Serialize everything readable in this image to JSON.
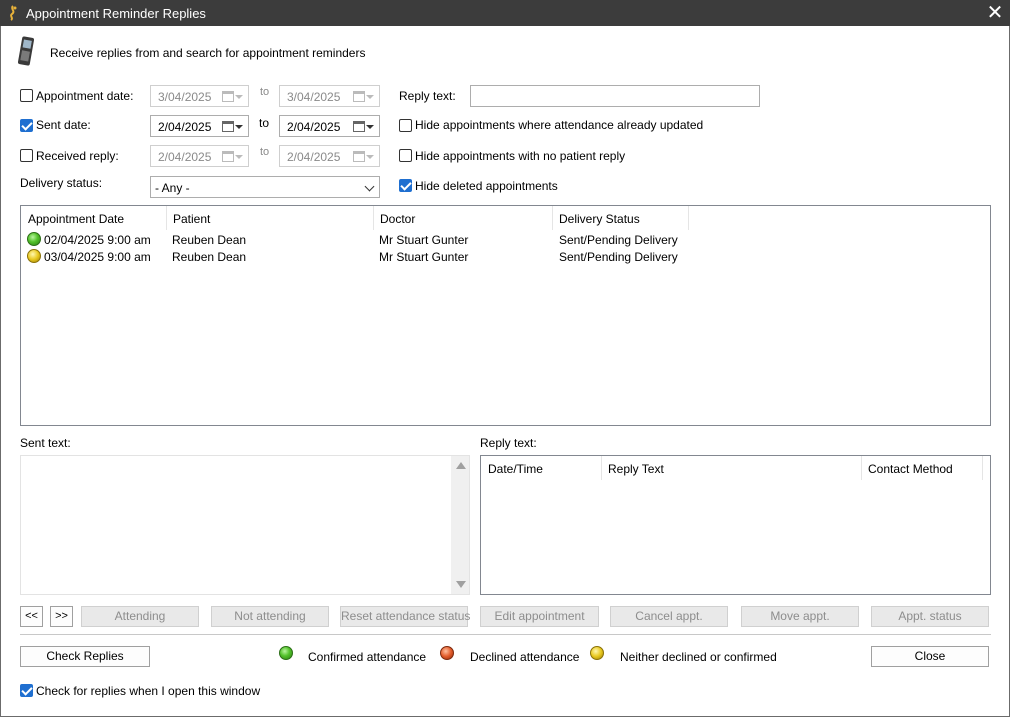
{
  "window": {
    "title": "Appointment Reminder Replies",
    "close_glyph": "✕"
  },
  "header": {
    "description": "Receive replies from and search for appointment reminders",
    "icon": "mobile-phone-icon"
  },
  "filters": {
    "appointment_date": {
      "label": "Appointment date:",
      "checked": false,
      "from": "3/04/2025",
      "to_label": "to",
      "to": "3/04/2025"
    },
    "sent_date": {
      "label": "Sent date:",
      "checked": true,
      "from": "2/04/2025",
      "to_label": "to",
      "to": "2/04/2025"
    },
    "received_reply": {
      "label": "Received reply:",
      "checked": false,
      "from": "2/04/2025",
      "to_label": "to",
      "to": "2/04/2025"
    },
    "delivery_status": {
      "label": "Delivery status:",
      "value": "- Any -"
    },
    "reply_text": {
      "label": "Reply text:",
      "value": ""
    },
    "hide_attendance_updated": {
      "label": "Hide appointments where attendance already updated",
      "checked": false
    },
    "hide_no_reply": {
      "label": "Hide appointments with no patient reply",
      "checked": false
    },
    "hide_deleted": {
      "label": "Hide deleted appointments",
      "checked": true
    }
  },
  "appointments": {
    "columns": [
      "Appointment Date",
      "Patient",
      "Doctor",
      "Delivery Status"
    ],
    "rows": [
      {
        "status": "green",
        "date": "02/04/2025 9:00 am",
        "patient": "Reuben Dean",
        "doctor": "Mr Stuart Gunter",
        "delivery": "Sent/Pending Delivery"
      },
      {
        "status": "yellow",
        "date": "03/04/2025 9:00 am",
        "patient": "Reuben Dean",
        "doctor": "Mr Stuart Gunter",
        "delivery": "Sent/Pending Delivery"
      }
    ]
  },
  "sent_text": {
    "label": "Sent text:",
    "value": ""
  },
  "reply_panel": {
    "label": "Reply text:",
    "columns": [
      "Date/Time",
      "Reply Text",
      "Contact Method"
    ]
  },
  "actions": {
    "prev": "<<",
    "next": ">>",
    "attending": "Attending",
    "not_attending": "Not attending",
    "reset_attendance": "Reset attendance status",
    "edit_appointment": "Edit appointment",
    "cancel_appt": "Cancel appt.",
    "move_appt": "Move appt.",
    "appt_status": "Appt. status"
  },
  "footer": {
    "check_replies": "Check Replies",
    "legend": [
      {
        "color": "green",
        "label": "Confirmed attendance"
      },
      {
        "color": "red",
        "label": "Declined attendance"
      },
      {
        "color": "yellow",
        "label": "Neither declined or confirmed"
      }
    ],
    "close": "Close",
    "check_on_open": {
      "label": "Check for replies when I open this window",
      "checked": true
    }
  },
  "colors": {
    "titlebar": "#3c3c3c",
    "checkbox_checked": "#1f6fd0",
    "confirmed": "#53c22b",
    "declined": "#e25b2a",
    "neither": "#e8c81e"
  }
}
